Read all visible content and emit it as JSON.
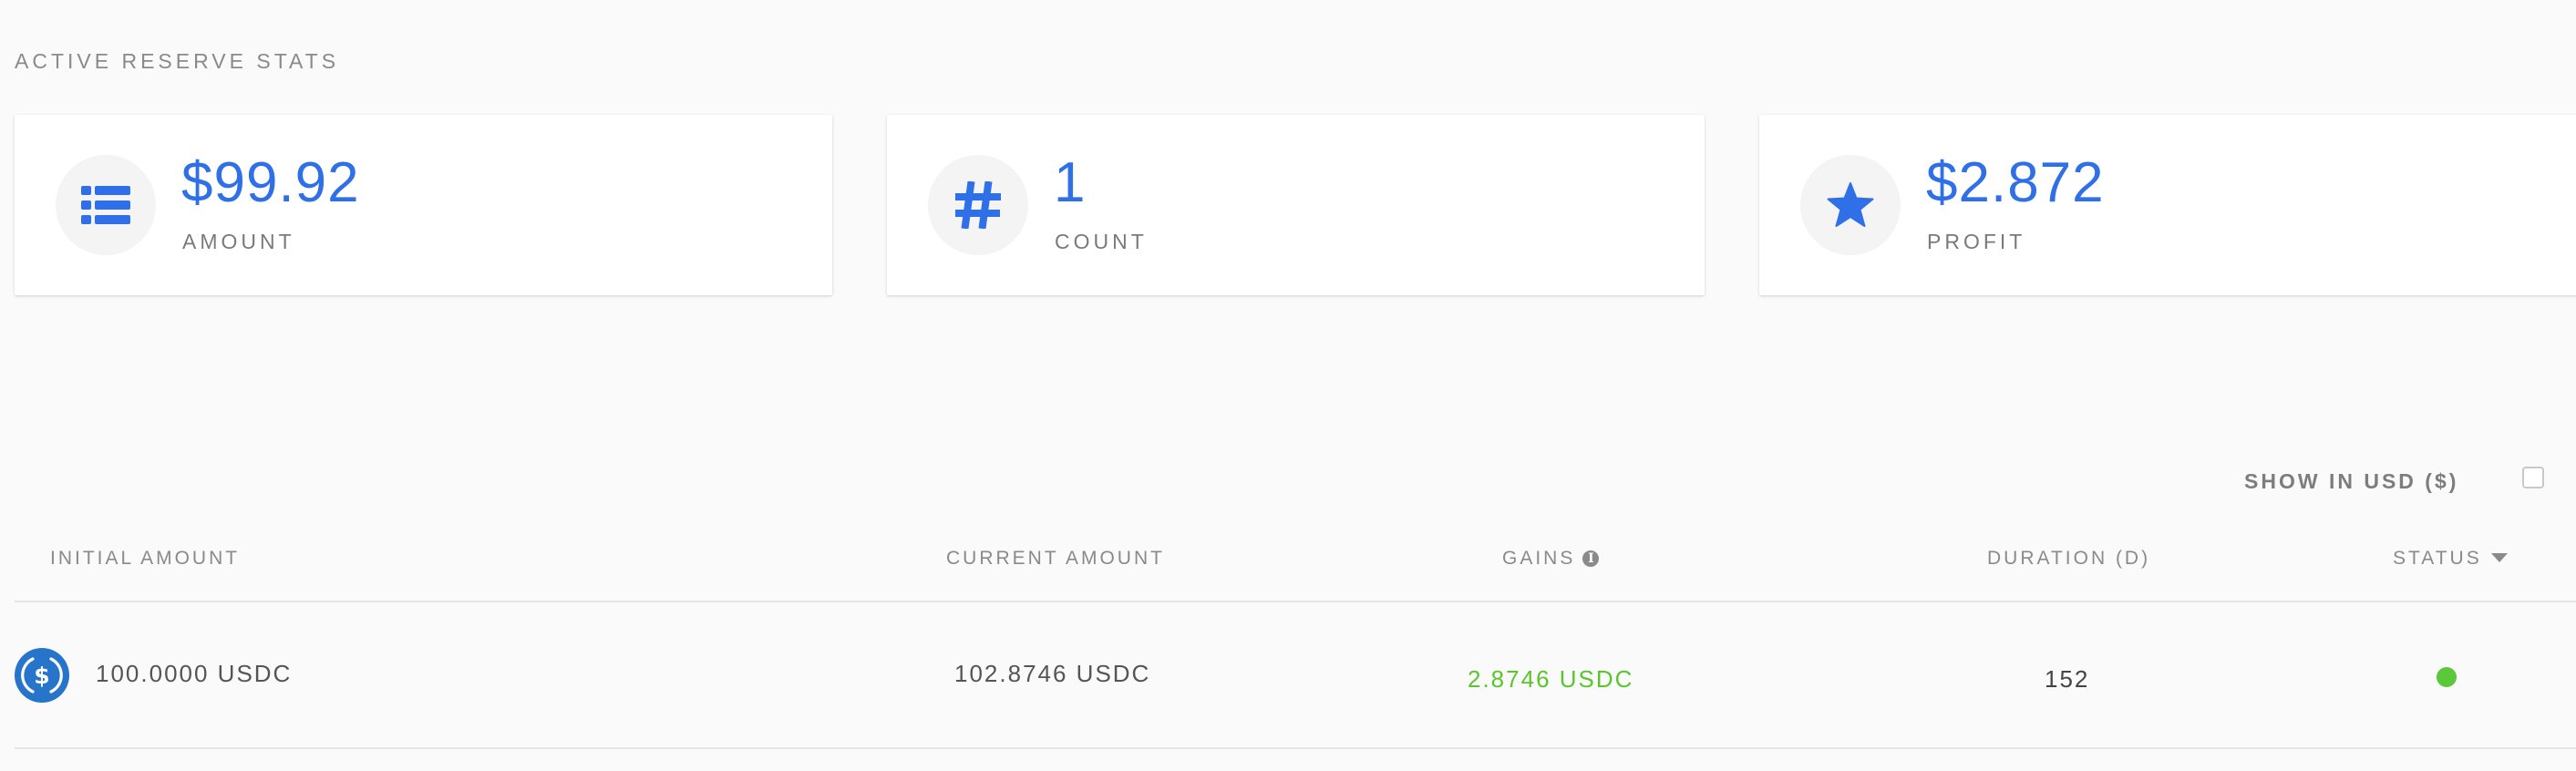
{
  "section": {
    "title": "ACTIVE RESERVE STATS"
  },
  "stats": [
    {
      "icon": "list-icon",
      "value": "$99.92",
      "label": "AMOUNT"
    },
    {
      "icon": "hash-icon",
      "value": "1",
      "label": "COUNT"
    },
    {
      "icon": "star-icon",
      "value": "$2.872",
      "label": "PROFIT"
    }
  ],
  "toggle": {
    "label": "SHOW IN USD ($)",
    "checked": false
  },
  "table": {
    "headers": {
      "initial": "INITIAL AMOUNT",
      "current": "CURRENT AMOUNT",
      "gains": "GAINS",
      "duration": "DURATION (D)",
      "status": "STATUS"
    },
    "rows": [
      {
        "coin_icon": "usdc-icon",
        "initial": "100.0000 USDC",
        "current": "102.8746 USDC",
        "gains": "2.8746 USDC",
        "duration": "152",
        "status": "active"
      }
    ]
  },
  "colors": {
    "accent": "#2f6fe8",
    "gains": "#5bc52d",
    "status_active": "#5ac83a",
    "usdc": "#2775ca"
  }
}
